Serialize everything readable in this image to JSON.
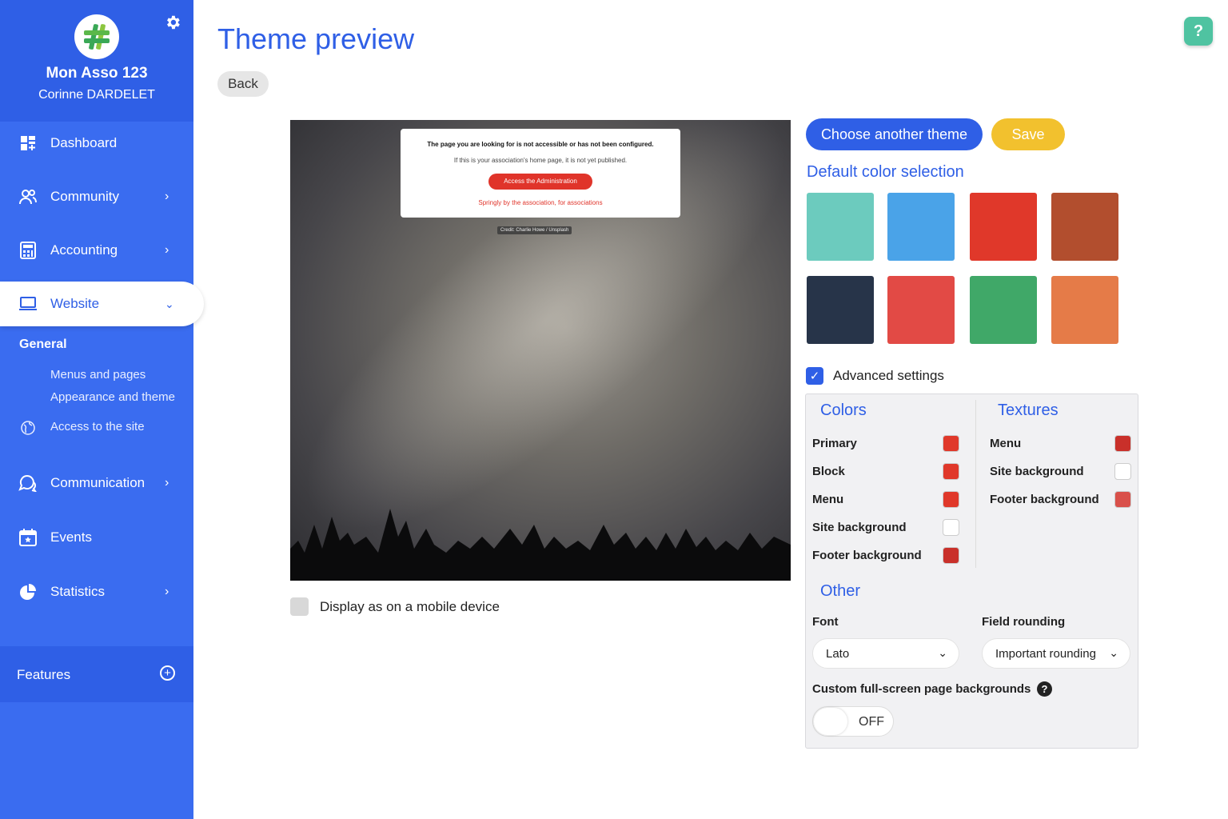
{
  "sidebar": {
    "org_name": "Mon Asso 123",
    "user_name": "Corinne DARDELET",
    "items": [
      {
        "label": "Dashboard",
        "icon": "dashboard-icon"
      },
      {
        "label": "Community",
        "icon": "community-icon"
      },
      {
        "label": "Accounting",
        "icon": "accounting-icon"
      },
      {
        "label": "Website",
        "icon": "laptop-icon"
      },
      {
        "label": "Communication",
        "icon": "chat-icon"
      },
      {
        "label": "Events",
        "icon": "calendar-icon"
      },
      {
        "label": "Statistics",
        "icon": "pie-chart-icon"
      }
    ],
    "submenu": {
      "heading": "General",
      "links": [
        "Menus and pages",
        "Appearance and theme",
        "Access to the site"
      ]
    },
    "features_label": "Features",
    "colors": {
      "bg": "#3a6cf0",
      "header": "#2f5fe6"
    }
  },
  "page": {
    "title": "Theme preview",
    "back_label": "Back"
  },
  "preview": {
    "message": "The page you are looking for is not accessible or has not been configured.",
    "sub_message": "If this is your association's home page, it is not yet published.",
    "button": "Access the Administration",
    "tagline": "Springly by the association, for associations",
    "credit": "Credit: Charlie Howe / Unsplash",
    "mobile_label": "Display as on a mobile device"
  },
  "actions": {
    "choose_theme": "Choose another theme",
    "save": "Save"
  },
  "default_colors": {
    "title": "Default color selection",
    "swatches": [
      "#6ccbbe",
      "#4aa3e8",
      "#e0382a",
      "#b24e2e",
      "#273449",
      "#e24a45",
      "#40a868",
      "#e57b48"
    ]
  },
  "advanced": {
    "label": "Advanced settings",
    "checked": true
  },
  "colors_section": {
    "title": "Colors",
    "rows": [
      {
        "label": "Primary",
        "color": "#e0382a"
      },
      {
        "label": "Block",
        "color": "#e0382a"
      },
      {
        "label": "Menu",
        "color": "#e0382a"
      },
      {
        "label": "Site background",
        "color": "#ffffff"
      },
      {
        "label": "Footer background",
        "color": "#c9302a"
      }
    ]
  },
  "textures_section": {
    "title": "Textures",
    "rows": [
      {
        "label": "Menu",
        "color": "#c9302a"
      },
      {
        "label": "Site background",
        "color": "#ffffff"
      },
      {
        "label": "Footer background",
        "color": "#d9504a"
      }
    ]
  },
  "other_section": {
    "title": "Other",
    "font_label": "Font",
    "font_value": "Lato",
    "rounding_label": "Field rounding",
    "rounding_value": "Important rounding",
    "custom_bg_label": "Custom full-screen page backgrounds",
    "toggle_value": "OFF"
  }
}
